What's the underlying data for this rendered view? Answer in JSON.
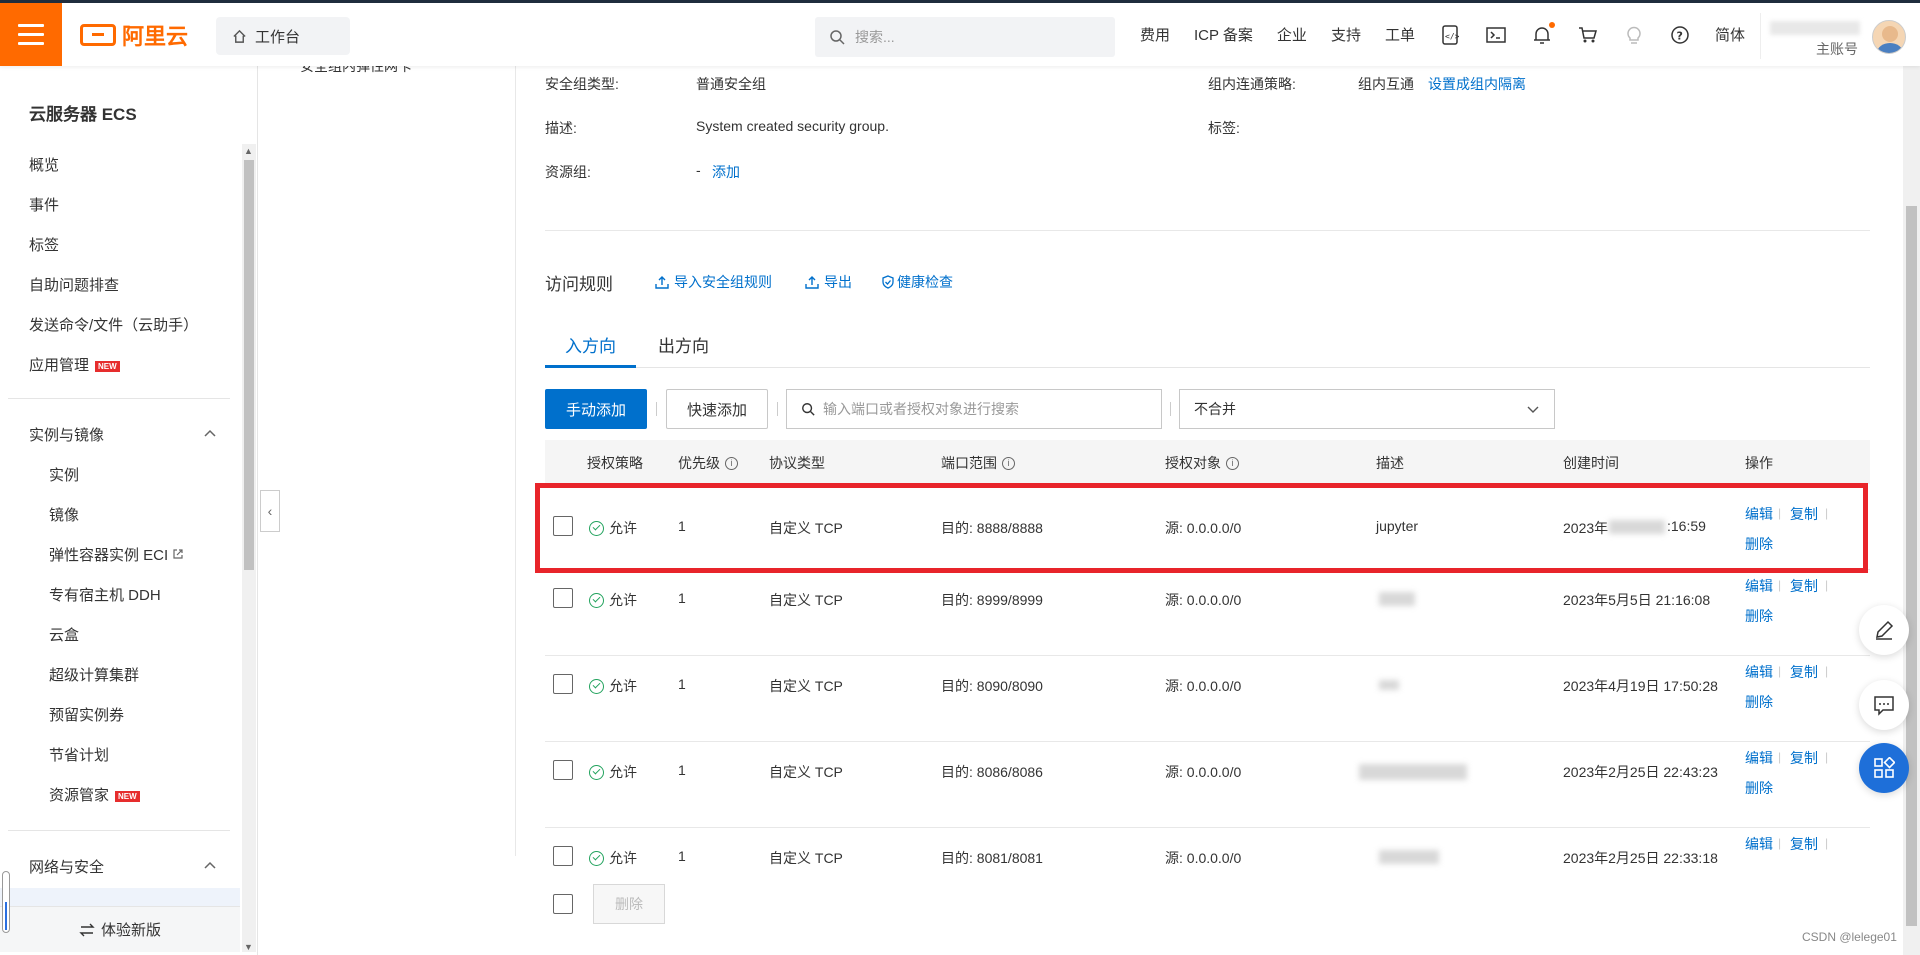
{
  "header": {
    "logo_text": "阿里云",
    "workbench": "工作台",
    "search_placeholder": "搜索...",
    "nav": [
      "费用",
      "ICP 备案",
      "企业",
      "支持",
      "工单"
    ],
    "language": "简体",
    "account_sub": "主账号"
  },
  "sidebar": {
    "title": "云服务器 ECS",
    "items": [
      "概览",
      "事件",
      "标签",
      "自助问题排查",
      "发送命令/文件（云助手）",
      "应用管理"
    ],
    "new_badge": "NEW",
    "group1": {
      "title": "实例与镜像",
      "items": [
        "实例",
        "镜像",
        "弹性容器实例 ECI",
        "专有宿主机 DDH",
        "云盒",
        "超级计算集群",
        "预留实例券",
        "节省计划",
        "资源管家"
      ]
    },
    "group2": {
      "title": "网络与安全"
    },
    "bottom_button": "体验新版"
  },
  "sec_nav": {
    "clipped_item": "安全组内弹性网卡"
  },
  "details": {
    "type_label": "安全组类型:",
    "type_value": "普通安全组",
    "policy_label": "组内连通策略:",
    "policy_value": "组内互通",
    "policy_link": "设置成组内隔离",
    "desc_label": "描述:",
    "desc_value": "System created security group.",
    "tags_label": "标签:",
    "resgroup_label": "资源组:",
    "resgroup_value": "-",
    "resgroup_link": "添加"
  },
  "rules": {
    "title": "访问规则",
    "actions": [
      "导入安全组规则",
      "导出",
      "健康检查"
    ],
    "tabs": [
      "入方向",
      "出方向"
    ],
    "btn_manual": "手动添加",
    "btn_quick": "快速添加",
    "filter_placeholder": "输入端口或者授权对象进行搜索",
    "merge_value": "不合并",
    "columns": [
      "授权策略",
      "优先级",
      "协议类型",
      "端口范围",
      "授权对象",
      "描述",
      "创建时间",
      "操作"
    ],
    "rows": [
      {
        "policy": "允许",
        "priority": "1",
        "protocol": "自定义 TCP",
        "port": "目的: 8888/8888",
        "target": "源: 0.0.0.0/0",
        "desc": "jupyter",
        "time_a": "2023年",
        "time_b": ":16:59"
      },
      {
        "policy": "允许",
        "priority": "1",
        "protocol": "自定义 TCP",
        "port": "目的: 8999/8999",
        "target": "源: 0.0.0.0/0",
        "desc": "",
        "time_a": "2023年5月5日 21:16:08",
        "time_b": ""
      },
      {
        "policy": "允许",
        "priority": "1",
        "protocol": "自定义 TCP",
        "port": "目的: 8090/8090",
        "target": "源: 0.0.0.0/0",
        "desc": "",
        "time_a": "2023年4月19日 17:50:28",
        "time_b": ""
      },
      {
        "policy": "允许",
        "priority": "1",
        "protocol": "自定义 TCP",
        "port": "目的: 8086/8086",
        "target": "源: 0.0.0.0/0",
        "desc": "",
        "time_a": "2023年2月25日 22:43:23",
        "time_b": ""
      },
      {
        "policy": "允许",
        "priority": "1",
        "protocol": "自定义 TCP",
        "port": "目的: 8081/8081",
        "target": "源: 0.0.0.0/0",
        "desc": "",
        "time_a": "2023年2月25日 22:33:18",
        "time_b": ""
      }
    ],
    "op_edit": "编辑",
    "op_copy": "复制",
    "op_delete": "删除",
    "btn_delete": "删除"
  },
  "watermark": "CSDN @lelege01"
}
